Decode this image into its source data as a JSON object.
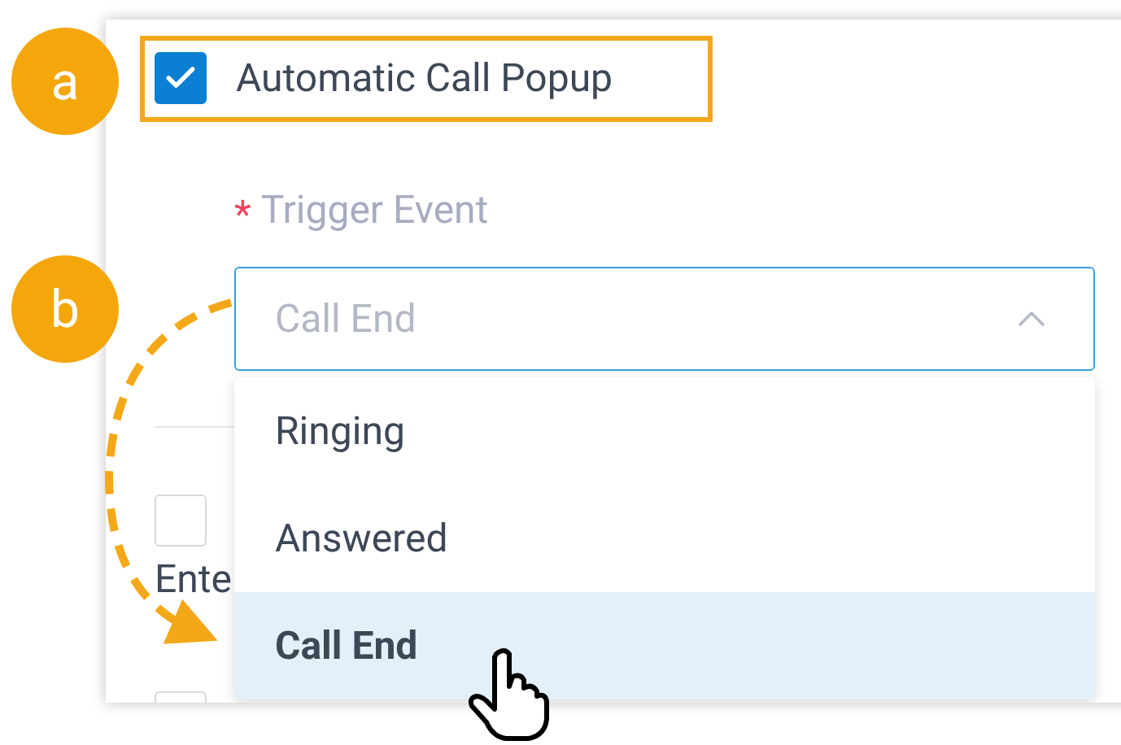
{
  "annotations": [
    {
      "label": "a"
    },
    {
      "label": "b"
    }
  ],
  "popup_option": {
    "label": "Automatic Call Popup",
    "checked": true
  },
  "trigger_event": {
    "label": "Trigger Event",
    "required_mark": "*",
    "value": "Call End",
    "expanded": true,
    "options": [
      {
        "label": "Ringing",
        "selected": false
      },
      {
        "label": "Answered",
        "selected": false
      },
      {
        "label": "Call End",
        "selected": true
      }
    ]
  },
  "other_options": [
    {
      "label": "Ente",
      "checked": false
    },
    {
      "checked": false
    }
  ]
}
